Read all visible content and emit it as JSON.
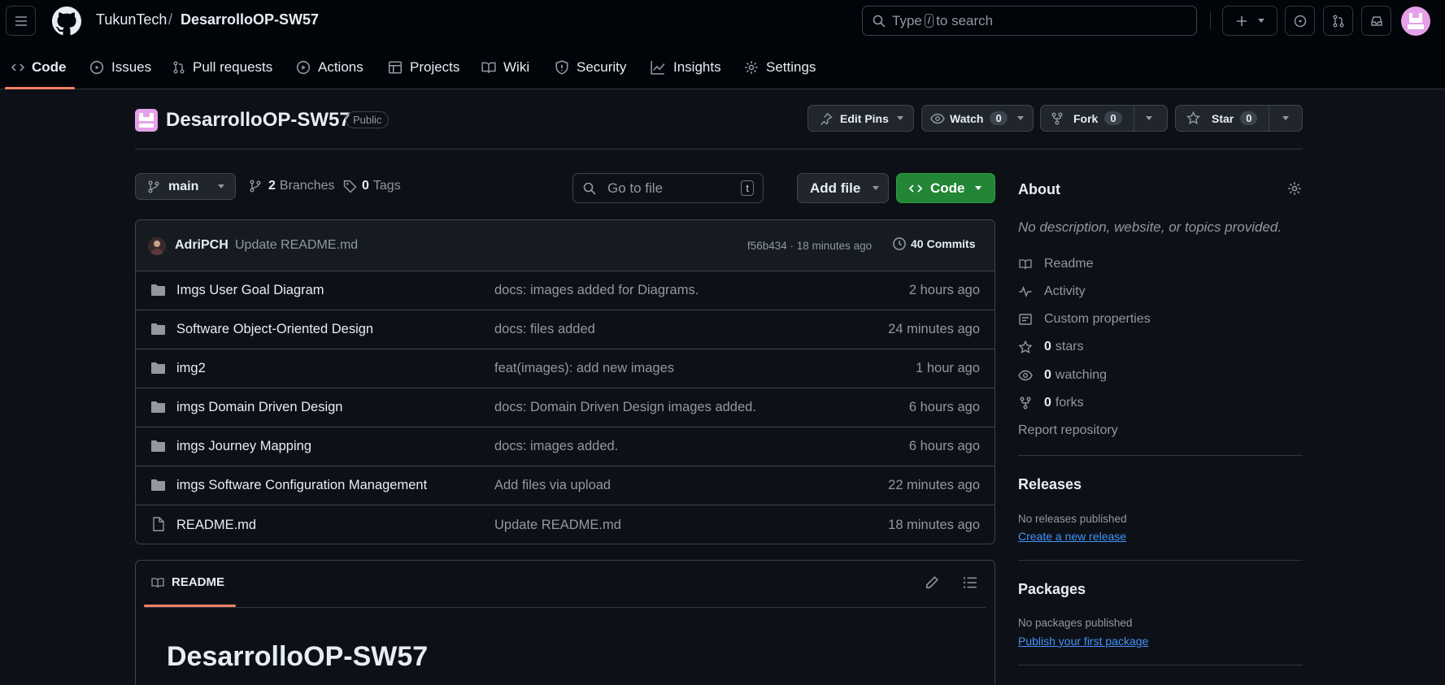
{
  "header": {
    "owner": "TukunTech",
    "separator": "/",
    "repo": "DesarrolloOP-SW57",
    "search": {
      "prefix": "Type",
      "key": "/",
      "suffix": "to search"
    }
  },
  "nav": {
    "tabs": [
      {
        "label": "Code",
        "icon": "code-icon",
        "active": true
      },
      {
        "label": "Issues",
        "icon": "issue-icon"
      },
      {
        "label": "Pull requests",
        "icon": "pull-request-icon"
      },
      {
        "label": "Actions",
        "icon": "play-icon"
      },
      {
        "label": "Projects",
        "icon": "table-icon"
      },
      {
        "label": "Wiki",
        "icon": "book-icon"
      },
      {
        "label": "Security",
        "icon": "shield-icon"
      },
      {
        "label": "Insights",
        "icon": "graph-icon"
      },
      {
        "label": "Settings",
        "icon": "gear-icon"
      }
    ]
  },
  "repo": {
    "name": "DesarrolloOP-SW57",
    "visibility": "Public",
    "edit_pins": "Edit Pins",
    "watch": {
      "label": "Watch",
      "count": "0"
    },
    "fork": {
      "label": "Fork",
      "count": "0"
    },
    "star": {
      "label": "Star",
      "count": "0"
    }
  },
  "toolbar": {
    "branch": "main",
    "branches_count": "2",
    "branches_label": "Branches",
    "tags_count": "0",
    "tags_label": "Tags",
    "go_to_file": "Go to file",
    "go_to_file_key": "t",
    "add_file": "Add file",
    "code": "Code"
  },
  "latest_commit": {
    "author": "AdriPCH",
    "message": "Update README.md",
    "hash_time": "f56b434 · 18 minutes ago",
    "commits_count": "40",
    "commits_label": "Commits"
  },
  "files": [
    {
      "type": "folder",
      "name": "Imgs User Goal Diagram",
      "message": "docs: images added for Diagrams.",
      "time": "2 hours ago"
    },
    {
      "type": "folder",
      "name": "Software Object-Oriented Design",
      "message": "docs: files added",
      "time": "24 minutes ago"
    },
    {
      "type": "folder",
      "name": "img2",
      "message": "feat(images): add new images",
      "time": "1 hour ago"
    },
    {
      "type": "folder",
      "name": "imgs Domain Driven Design",
      "message": "docs: Domain Driven Design images added.",
      "time": "6 hours ago"
    },
    {
      "type": "folder",
      "name": "imgs Journey Mapping",
      "message": "docs: images added.",
      "time": "6 hours ago"
    },
    {
      "type": "folder",
      "name": "imgs Software Configuration Management",
      "message": "Add files via upload",
      "time": "22 minutes ago"
    },
    {
      "type": "file",
      "name": "README.md",
      "message": "Update README.md",
      "time": "18 minutes ago"
    }
  ],
  "readme": {
    "tab_label": "README",
    "heading": "DesarrolloOP-SW57"
  },
  "about": {
    "title": "About",
    "description": "No description, website, or topics provided.",
    "readme": "Readme",
    "activity": "Activity",
    "custom_properties": "Custom properties",
    "stars_count": "0",
    "stars_label": "stars",
    "watching_count": "0",
    "watching_label": "watching",
    "forks_count": "0",
    "forks_label": "forks",
    "report": "Report repository"
  },
  "releases": {
    "title": "Releases",
    "empty": "No releases published",
    "link": "Create a new release"
  },
  "packages": {
    "title": "Packages",
    "empty": "No packages published",
    "link": "Publish your first package"
  },
  "colors": {
    "background": "#0d1117",
    "header": "#010409",
    "accent_green": "#238636",
    "link_blue": "#4493f8",
    "active_tab": "#f78166"
  }
}
